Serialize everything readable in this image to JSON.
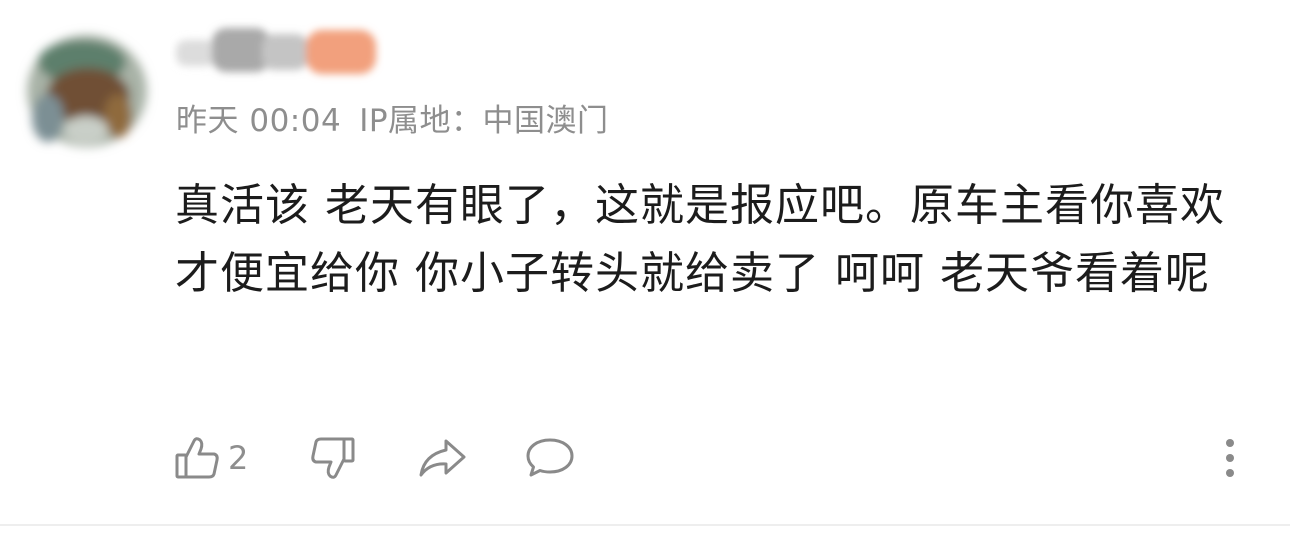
{
  "comment": {
    "meta": {
      "time": "昨天 00:04",
      "location": "IP属地：中国澳门"
    },
    "text": "真活该 老天有眼了，这就是报应吧。原车主看你喜欢才便宜给你 你小子转头就给卖了 呵呵 老天爷看着呢",
    "actions": {
      "like_count": "2"
    }
  },
  "icons": {
    "like": "thumbs-up-icon",
    "dislike": "thumbs-down-icon",
    "share": "share-icon",
    "reply": "comment-icon",
    "more": "more-vertical-icon"
  },
  "colors": {
    "text": "#1c1c1c",
    "secondary": "#8e8e8e",
    "icon": "#8a8a8a"
  }
}
